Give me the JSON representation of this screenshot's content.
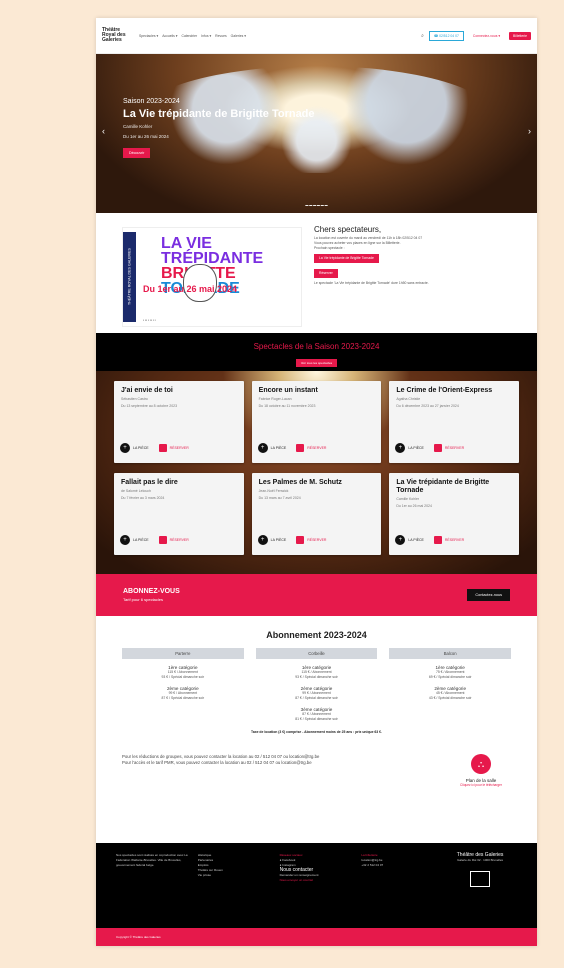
{
  "header": {
    "logo": "Théâtre Royal des Galeries",
    "nav": [
      "Spectacles ▾",
      "Accueils ▾",
      "Calendrier",
      "Infos ▾",
      "Revues",
      "Galeries ▾"
    ],
    "phone": "☎ 02/512 04 07",
    "account": "Connectez-vous ▾",
    "cta": "Billetterie"
  },
  "hero": {
    "season": "Saison 2023-2024",
    "title": "La Vie trépidante de Brigitte Tornade",
    "author": "Camille Kohler",
    "dates": "Du 1er au 26 mai 2024",
    "button": "Découvrir"
  },
  "info": {
    "poster_side": "THÉÂTRE ROYAL DES GALERIES",
    "poster_title_1": "LA VIE TRÉPIDANTE",
    "poster_title_2": "BRIGITTE",
    "poster_title_3": "TORNADE",
    "poster_date": "Du 1er au 26 mai 2024",
    "greeting_title": "Chers spectateurs,",
    "greeting_text": "La location est ouverte du mardi au vendredi de 11h à 18h 02/512 04 07",
    "greeting_text2": "Vous pouvez acheter vos places en ligne sur la Billetterie.",
    "greeting_label": "Prochain spectacle :",
    "btn_show": "La Vie trépidante de Brigitte Tornade",
    "btn_book": "Réserver",
    "greeting_footer": "Le spectacle 'La Vie trépidante de Brigitte Tornade' dure 1h50 sans entracte."
  },
  "season": {
    "title": "Spectacles de la Saison 2023-2024",
    "button": "Voir tous les spectacles",
    "piece_label": "LA PIÈCE",
    "reserve_label": "RÉSERVER",
    "cards": [
      {
        "title": "J'ai envie de toi",
        "author": "Sébastien Castro",
        "dates": "Du 13 septembre au 8 octobre 2023"
      },
      {
        "title": "Encore un instant",
        "author": "Fabrice Roger-Lacan",
        "dates": "Du 18 octobre au 11 novembre 2023"
      },
      {
        "title": "Le Crime de l'Orient-Express",
        "author": "Agatha Christie",
        "dates": "Du 6 décembre 2023 au 27 janvier 2024"
      },
      {
        "title": "Fallait pas le dire",
        "author": "de Salomé Lelouch",
        "dates": "Du 7 février au 3 mars 2024"
      },
      {
        "title": "Les Palmes de M. Schutz",
        "author": "Jean-Noël Fenwick",
        "dates": "Du 13 mars au 7 avril 2024"
      },
      {
        "title": "La Vie trépidante de Brigitte Tornade",
        "author": "Camille Kohler",
        "dates": "Du 1er au 26 mai 2024"
      }
    ]
  },
  "subscribe": {
    "title": "ABONNEZ-VOUS",
    "subtitle": "Tarif pour 6 spectacles",
    "button": "Contactez-nous"
  },
  "abo": {
    "title": "Abonnement 2023-2024",
    "columns": [
      {
        "name": "Parterre",
        "tiers": [
          {
            "t": "1ère catégorie",
            "a": "115 € / Abonnement",
            "b": "93 € / Spécial dimanche soir"
          },
          {
            "t": "2ème catégorie",
            "a": "99 € / Abonnement",
            "b": "87 € / Spécial dimanche soir"
          }
        ]
      },
      {
        "name": "Corbeille",
        "tiers": [
          {
            "t": "1ère catégorie",
            "a": "115 € / Abonnement",
            "b": "93 € / Spécial dimanche soir"
          },
          {
            "t": "2ème catégorie",
            "a": "99 € / Abonnement",
            "b": "87 € / Spécial dimanche soir"
          },
          {
            "t": "3ème catégorie",
            "a": "87 € / Abonnement",
            "b": "81 € / Spécial dimanche soir"
          }
        ]
      },
      {
        "name": "Balcon",
        "tiers": [
          {
            "t": "1ère catégorie",
            "a": "75 € / Abonnement",
            "b": "69 € / Spécial dimanche soir"
          },
          {
            "t": "2ème catégorie",
            "a": "45 € / Abonnement",
            "b": "43 € / Spécial dimanche soir"
          }
        ]
      }
    ],
    "tax": "Taxe de location (3 €) comprise - Abonnement moins de 25 ans : prix unique 63 €."
  },
  "contact": {
    "line1": "Pour les réductions de groupes, vous pouvez contacter la location au 02 / 512 04 07 ou location@trg.be",
    "line2": "Pour l'accès et le tarif PMR, vous pouvez contacter la location au 02 / 512 04 07 ou location@trg.be",
    "plan": "Plan de la salle",
    "plan_link": "Cliquez ici pour le télécharger"
  },
  "footer": {
    "about": "Nos spectacles sont réalisés en coproduction avec La Fédération Wallonie-Bruxelles. Ville de Bruxelles, gouvernement fédéral belge.",
    "links": [
      "Historique",
      "Partenaires",
      "Emplois",
      "Théâtre sur Rouen",
      "Vie privée"
    ],
    "social_title": "Réseaux sociaux",
    "social": [
      "Facebook",
      "Instagram"
    ],
    "contact_title": "Nous contacter",
    "contact_links": [
      "Demander un renseignement",
      "Nous envoyer un courriel"
    ],
    "billet_title": "La billetterie",
    "billet": [
      "location@trg.be",
      "+32 2 512 04 07"
    ],
    "brand": "Théâtre des Galeries",
    "address": "Galerie du Roi 32 · 1000 Bruxelles",
    "copyright": "Copyright © Théâtre des Galeries"
  }
}
